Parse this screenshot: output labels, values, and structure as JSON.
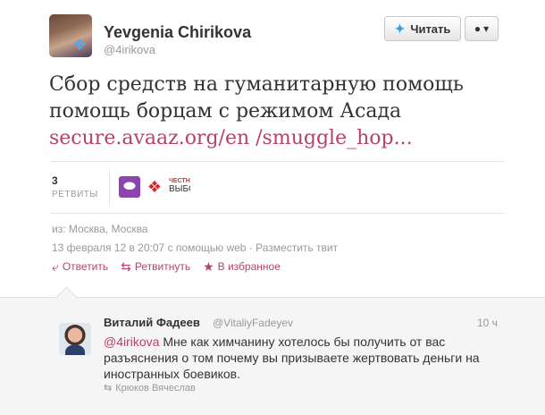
{
  "tweet": {
    "author_name": "Yevgenia Chirikova",
    "author_handle": "@4irikova",
    "text_plain": "Сбор средств на гуманитарную помощь помощь борцам с режимом Асада ",
    "text_link": "secure.avaaz.org/en /smuggle_hop...",
    "follow_label": "Читать",
    "retweets_count": "3",
    "retweets_label": "РЕТВИТЫ",
    "location": "из: Москва, Москва",
    "timestamp": "13 февраля 12 в 20:07",
    "via": "с помощью web",
    "separator": "·",
    "embed_label": "Разместить твит",
    "actions": {
      "reply": "Ответить",
      "retweet": "Ретвитнуть",
      "favorite": "В избранное"
    },
    "retweeter_avatars": [
      {
        "icon": "egg-avatar"
      },
      {
        "icon": "red-ribbon-avatar"
      },
      {
        "icon": "crowd-avatar",
        "top_text": "ЧЕСТНЫЕ",
        "bottom_text": "ВЫБОРЫ"
      }
    ]
  },
  "reply": {
    "author_name": "Виталий Фадеев",
    "author_handle": "@VitaliyFadeyev",
    "time": "10 ч",
    "mention": "@4irikova",
    "text": " Мне как химчанину хотелось бы получить от вас разъяснения о том почему вы призываете жертвовать деньги на иностранных боевиков.",
    "retweeted_by": "Крюков Вячеслав"
  },
  "colors": {
    "link": "#b5426b",
    "muted": "#999999",
    "reply_bg": "#f5f5f5",
    "twitter_blue": "#2aa3ef"
  }
}
